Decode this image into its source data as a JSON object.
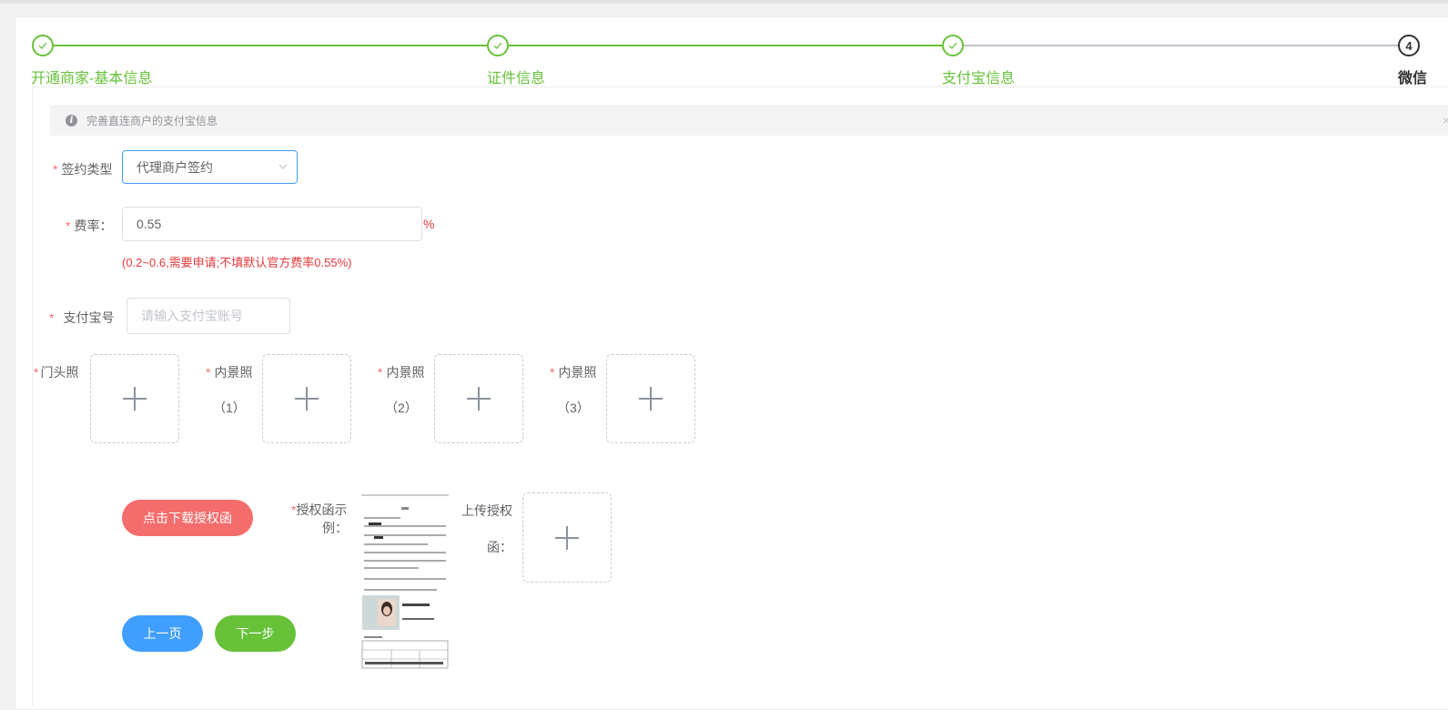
{
  "steps": [
    {
      "title": "开通商家-基本信息",
      "status": "done"
    },
    {
      "title": "证件信息",
      "status": "done"
    },
    {
      "title": "支付宝信息",
      "status": "done"
    },
    {
      "title": "微信",
      "status": "active",
      "number": "4"
    }
  ],
  "alert": {
    "text": "完善直连商户的支付宝信息",
    "close": "×"
  },
  "form": {
    "sign_type": {
      "required": "*",
      "label": "签约类型",
      "value": "代理商户签约"
    },
    "rate": {
      "required": "*",
      "label": "费率：",
      "value": "0.55",
      "unit": "%",
      "hint": "(0.2~0.6,需要申请;不填默认官方费率0.55%)"
    },
    "alipay_account": {
      "required": "*",
      "label": "支付宝号",
      "placeholder": "请输入支付宝账号"
    },
    "photos": {
      "storefront": {
        "required": "*",
        "label": "门头照"
      },
      "interior_1": {
        "required": "*",
        "label": "内景照",
        "index": "（1）"
      },
      "interior_2": {
        "required": "*",
        "label": "内景照",
        "index": "（2）"
      },
      "interior_3": {
        "required": "*",
        "label": "内景照",
        "index": "（3）"
      }
    },
    "authorization": {
      "download_label": "点击下载授权函",
      "sample_required": "*",
      "sample_label_1": "授权函示",
      "sample_label_2": "例：",
      "upload_label_1": "上传授权",
      "upload_label_2": "函："
    }
  },
  "buttons": {
    "prev": "上一页",
    "next": "下一步"
  }
}
